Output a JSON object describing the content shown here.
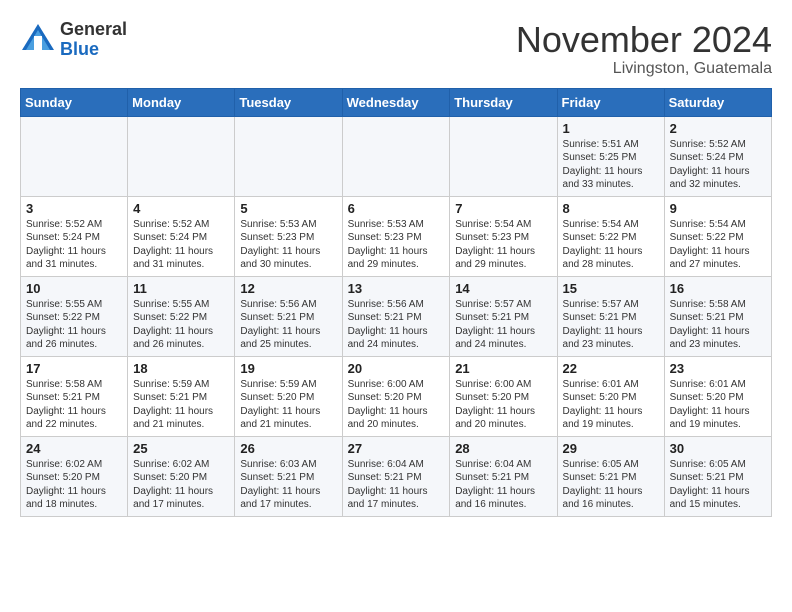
{
  "header": {
    "logo_general": "General",
    "logo_blue": "Blue",
    "month": "November 2024",
    "location": "Livingston, Guatemala"
  },
  "days_of_week": [
    "Sunday",
    "Monday",
    "Tuesday",
    "Wednesday",
    "Thursday",
    "Friday",
    "Saturday"
  ],
  "weeks": [
    [
      {
        "day": "",
        "info": ""
      },
      {
        "day": "",
        "info": ""
      },
      {
        "day": "",
        "info": ""
      },
      {
        "day": "",
        "info": ""
      },
      {
        "day": "",
        "info": ""
      },
      {
        "day": "1",
        "info": "Sunrise: 5:51 AM\nSunset: 5:25 PM\nDaylight: 11 hours\nand 33 minutes."
      },
      {
        "day": "2",
        "info": "Sunrise: 5:52 AM\nSunset: 5:24 PM\nDaylight: 11 hours\nand 32 minutes."
      }
    ],
    [
      {
        "day": "3",
        "info": "Sunrise: 5:52 AM\nSunset: 5:24 PM\nDaylight: 11 hours\nand 31 minutes."
      },
      {
        "day": "4",
        "info": "Sunrise: 5:52 AM\nSunset: 5:24 PM\nDaylight: 11 hours\nand 31 minutes."
      },
      {
        "day": "5",
        "info": "Sunrise: 5:53 AM\nSunset: 5:23 PM\nDaylight: 11 hours\nand 30 minutes."
      },
      {
        "day": "6",
        "info": "Sunrise: 5:53 AM\nSunset: 5:23 PM\nDaylight: 11 hours\nand 29 minutes."
      },
      {
        "day": "7",
        "info": "Sunrise: 5:54 AM\nSunset: 5:23 PM\nDaylight: 11 hours\nand 29 minutes."
      },
      {
        "day": "8",
        "info": "Sunrise: 5:54 AM\nSunset: 5:22 PM\nDaylight: 11 hours\nand 28 minutes."
      },
      {
        "day": "9",
        "info": "Sunrise: 5:54 AM\nSunset: 5:22 PM\nDaylight: 11 hours\nand 27 minutes."
      }
    ],
    [
      {
        "day": "10",
        "info": "Sunrise: 5:55 AM\nSunset: 5:22 PM\nDaylight: 11 hours\nand 26 minutes."
      },
      {
        "day": "11",
        "info": "Sunrise: 5:55 AM\nSunset: 5:22 PM\nDaylight: 11 hours\nand 26 minutes."
      },
      {
        "day": "12",
        "info": "Sunrise: 5:56 AM\nSunset: 5:21 PM\nDaylight: 11 hours\nand 25 minutes."
      },
      {
        "day": "13",
        "info": "Sunrise: 5:56 AM\nSunset: 5:21 PM\nDaylight: 11 hours\nand 24 minutes."
      },
      {
        "day": "14",
        "info": "Sunrise: 5:57 AM\nSunset: 5:21 PM\nDaylight: 11 hours\nand 24 minutes."
      },
      {
        "day": "15",
        "info": "Sunrise: 5:57 AM\nSunset: 5:21 PM\nDaylight: 11 hours\nand 23 minutes."
      },
      {
        "day": "16",
        "info": "Sunrise: 5:58 AM\nSunset: 5:21 PM\nDaylight: 11 hours\nand 23 minutes."
      }
    ],
    [
      {
        "day": "17",
        "info": "Sunrise: 5:58 AM\nSunset: 5:21 PM\nDaylight: 11 hours\nand 22 minutes."
      },
      {
        "day": "18",
        "info": "Sunrise: 5:59 AM\nSunset: 5:21 PM\nDaylight: 11 hours\nand 21 minutes."
      },
      {
        "day": "19",
        "info": "Sunrise: 5:59 AM\nSunset: 5:20 PM\nDaylight: 11 hours\nand 21 minutes."
      },
      {
        "day": "20",
        "info": "Sunrise: 6:00 AM\nSunset: 5:20 PM\nDaylight: 11 hours\nand 20 minutes."
      },
      {
        "day": "21",
        "info": "Sunrise: 6:00 AM\nSunset: 5:20 PM\nDaylight: 11 hours\nand 20 minutes."
      },
      {
        "day": "22",
        "info": "Sunrise: 6:01 AM\nSunset: 5:20 PM\nDaylight: 11 hours\nand 19 minutes."
      },
      {
        "day": "23",
        "info": "Sunrise: 6:01 AM\nSunset: 5:20 PM\nDaylight: 11 hours\nand 19 minutes."
      }
    ],
    [
      {
        "day": "24",
        "info": "Sunrise: 6:02 AM\nSunset: 5:20 PM\nDaylight: 11 hours\nand 18 minutes."
      },
      {
        "day": "25",
        "info": "Sunrise: 6:02 AM\nSunset: 5:20 PM\nDaylight: 11 hours\nand 17 minutes."
      },
      {
        "day": "26",
        "info": "Sunrise: 6:03 AM\nSunset: 5:21 PM\nDaylight: 11 hours\nand 17 minutes."
      },
      {
        "day": "27",
        "info": "Sunrise: 6:04 AM\nSunset: 5:21 PM\nDaylight: 11 hours\nand 17 minutes."
      },
      {
        "day": "28",
        "info": "Sunrise: 6:04 AM\nSunset: 5:21 PM\nDaylight: 11 hours\nand 16 minutes."
      },
      {
        "day": "29",
        "info": "Sunrise: 6:05 AM\nSunset: 5:21 PM\nDaylight: 11 hours\nand 16 minutes."
      },
      {
        "day": "30",
        "info": "Sunrise: 6:05 AM\nSunset: 5:21 PM\nDaylight: 11 hours\nand 15 minutes."
      }
    ]
  ]
}
